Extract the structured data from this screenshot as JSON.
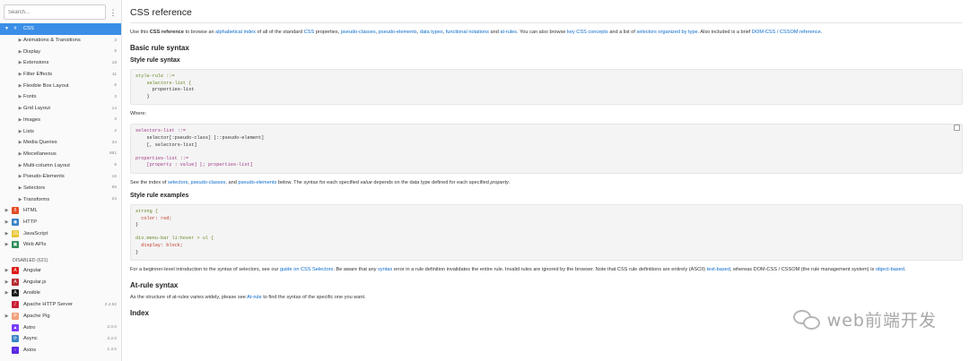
{
  "sidebar": {
    "search_placeholder": "Search...",
    "menu_icon": "⋮",
    "css_root": {
      "label": "CSS",
      "icon": "#"
    },
    "css_items": [
      {
        "label": "Animations & Transitions",
        "count": "3"
      },
      {
        "label": "Display",
        "count": "6"
      },
      {
        "label": "Extensions",
        "count": "18"
      },
      {
        "label": "Filter Effects",
        "count": "11"
      },
      {
        "label": "Flexible Box Layout",
        "count": "6"
      },
      {
        "label": "Fonts",
        "count": "3"
      },
      {
        "label": "Grid Layout",
        "count": "14"
      },
      {
        "label": "Images",
        "count": "3"
      },
      {
        "label": "Lists",
        "count": "2"
      },
      {
        "label": "Media Queries",
        "count": "34"
      },
      {
        "label": "Miscellaneous",
        "count": "861"
      },
      {
        "label": "Multi-column Layout",
        "count": "6"
      },
      {
        "label": "Pseudo-Elements",
        "count": "16"
      },
      {
        "label": "Selectors",
        "count": "65"
      },
      {
        "label": "Transforms",
        "count": "24"
      }
    ],
    "docs": [
      {
        "label": "HTML",
        "icon": "5",
        "color": "#e44d26"
      },
      {
        "label": "HTTP",
        "icon": "◉",
        "color": "#3b82c4"
      },
      {
        "label": "JavaScript",
        "icon": "JS",
        "color": "#e8c531"
      },
      {
        "label": "Web APIs",
        "icon": "▣",
        "color": "#2e8b57"
      }
    ],
    "disabled_label": "DISABLED (621)",
    "disabled": [
      {
        "label": "Angular",
        "icon": "A",
        "color": "#dd1b16",
        "count": ""
      },
      {
        "label": "Angular.js",
        "icon": "A",
        "color": "#b52e31",
        "count": ""
      },
      {
        "label": "Ansible",
        "icon": "A",
        "color": "#1a1918",
        "count": ""
      },
      {
        "label": "Apache HTTP Server",
        "icon": "/",
        "color": "#c92037",
        "count": "2.4.52"
      },
      {
        "label": "Apache Pig",
        "icon": "P",
        "color": "#f2a07b",
        "count": ""
      },
      {
        "label": "Astro",
        "icon": "▲",
        "color": "#7a3cff",
        "count": "2.0.0"
      },
      {
        "label": "Async",
        "icon": "⟳",
        "color": "#3a85c6",
        "count": "3.2.0"
      },
      {
        "label": "Axios",
        "icon": "›",
        "color": "#5a29e4",
        "count": "1.3.0"
      }
    ]
  },
  "main": {
    "title": "CSS reference",
    "intro": {
      "t1": "Use this ",
      "t2": "CSS reference",
      "t3": " to browse an ",
      "a1": "alphabetical index",
      "t4": " of all of the standard ",
      "a2": "CSS",
      "t5": " properties, ",
      "a3": "pseudo-classes",
      "t6": ", ",
      "a4": "pseudo-elements",
      "t7": ", ",
      "a5": "data types",
      "t8": ", ",
      "a6": "functional notations",
      "t9": " and ",
      "a7": "at-rules",
      "t10": ". You can also browse ",
      "a8": "key CSS concepts",
      "t11": " and a list of ",
      "a9": "selectors organized by type",
      "t12": ". Also included is a brief ",
      "a10": "DOM-CSS / CSSOM reference",
      "t13": "."
    },
    "h_basic": "Basic rule syntax",
    "h_style": "Style rule syntax",
    "code1": [
      {
        "cls": "g",
        "text": "style-rule ::="
      },
      {
        "cls": "g",
        "text": "    selectors-list {"
      },
      {
        "cls": "",
        "text": "      properties-list"
      },
      {
        "cls": "",
        "text": "    }"
      }
    ],
    "where": "Where:",
    "code2": [
      {
        "cls": "m",
        "text": "selectors-list ::="
      },
      {
        "cls": "",
        "text": "    selector[:pseudo-class] [::pseudo-element]"
      },
      {
        "cls": "",
        "text": "    [, selectors-list]"
      },
      {
        "cls": "",
        "text": " "
      },
      {
        "cls": "m",
        "text": "properties-list ::="
      },
      {
        "cls": "m",
        "text": "    [property : value] [; properties-list]"
      }
    ],
    "see": {
      "t1": "See the index of ",
      "a1": "selectors",
      "t2": ", ",
      "a2": "pseudo-classes",
      "t3": ", and ",
      "a3": "pseudo-elements",
      "t4": " below. The syntax for each specified ",
      "t5": "value",
      "t6": " depends on the data type defined for each specified ",
      "t7": "property",
      "t8": "."
    },
    "h_examples": "Style rule examples",
    "code3": [
      {
        "cls": "g",
        "text": "strong {"
      },
      {
        "cls": "k",
        "text": "  color: red;"
      },
      {
        "cls": "",
        "text": "}"
      },
      {
        "cls": "",
        "text": " "
      },
      {
        "cls": "g",
        "text": "div.menu-bar li:hover > ul {"
      },
      {
        "cls": "k",
        "text": "  display: block;"
      },
      {
        "cls": "",
        "text": "}"
      }
    ],
    "beginner": {
      "t1": "For a beginner-level introduction to the syntax of selectors, see our ",
      "a1": "guide on CSS Selectors",
      "t2": ". Be aware that any ",
      "a2": "syntax",
      "t3": " error in a rule definition invalidates the entire rule. Invalid rules are ignored by the browser. Note that CSS rule definitions are entirely (ASCII) ",
      "a3": "text-based",
      "t4": ", whereas DOM-CSS / CSSOM (the rule management system) is ",
      "a4": "object-based",
      "t5": "."
    },
    "h_atrule": "At-rule syntax",
    "atrule": {
      "t1": "As the structure of at-rules varies widely, please see ",
      "a1": "At-rule",
      "t2": " to find the syntax of the specific one you want."
    },
    "h_index": "Index"
  },
  "watermark": "web前端开发"
}
